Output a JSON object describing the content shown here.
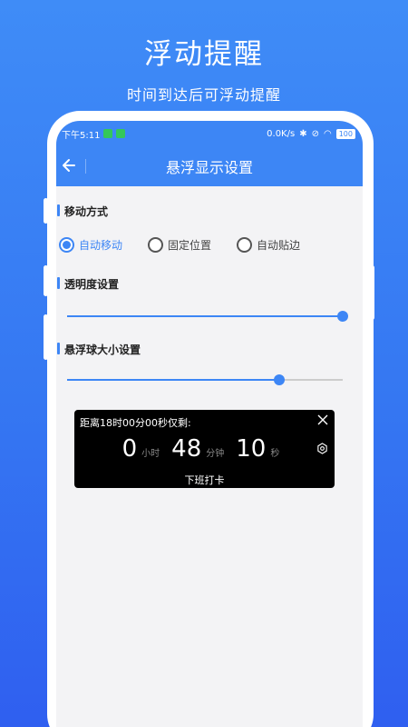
{
  "promo": {
    "title": "浮动提醒",
    "subtitle": "时间到达后可浮动提醒"
  },
  "status_bar": {
    "time": "下午5:11",
    "speed": "0.0K/s",
    "battery": "100"
  },
  "app_bar": {
    "title": "悬浮显示设置",
    "back_icon": "arrow-left-icon"
  },
  "sections": {
    "move_mode": {
      "title": "移动方式",
      "options": [
        {
          "label": "自动移动",
          "checked": true
        },
        {
          "label": "固定位置",
          "checked": false
        },
        {
          "label": "自动贴边",
          "checked": false
        }
      ]
    },
    "opacity": {
      "title": "透明度设置",
      "value": 1.0
    },
    "ball_size": {
      "title": "悬浮球大小设置",
      "value": 0.77
    }
  },
  "float_card": {
    "deadline": "距离18时00分00秒仅剩:",
    "hours": "0",
    "hours_unit": "小时",
    "minutes": "48",
    "minutes_unit": "分钟",
    "seconds": "10",
    "seconds_unit": "秒",
    "label": "下班打卡",
    "close_icon": "close-icon",
    "settings_icon": "settings-icon"
  },
  "colors": {
    "accent": "#3d86f5",
    "background_top": "#3f8cf7",
    "background_bottom": "#2f5ff0"
  }
}
